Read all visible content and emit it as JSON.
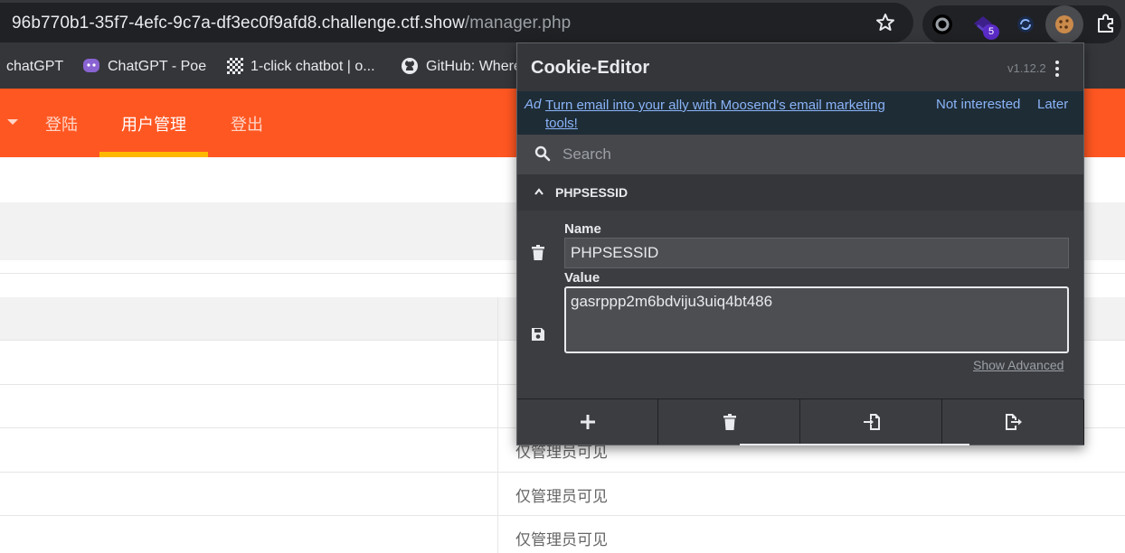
{
  "browser": {
    "url_main": "96b770b1-35f7-4efc-9c7a-df3ec0f9afd8.challenge.ctf.show",
    "url_path": "/manager.php",
    "extension_badge": "5",
    "bookmarks": [
      {
        "label": "chatGPT",
        "icon": "none"
      },
      {
        "label": "ChatGPT - Poe",
        "icon": "poe-icon"
      },
      {
        "label": "1-click chatbot | o...",
        "icon": "checker-icon"
      },
      {
        "label": "GitHub: Where",
        "icon": "github-icon"
      }
    ]
  },
  "site": {
    "nav": [
      {
        "label": "登陆",
        "active": false
      },
      {
        "label": "用户管理",
        "active": true
      },
      {
        "label": "登出",
        "active": false
      }
    ],
    "table_cells": [
      "仅管理员可见",
      "仅管理员可见",
      "仅管理员可见"
    ],
    "colors": {
      "nav_bg": "#ff5722",
      "nav_active_underline": "#ffb800"
    }
  },
  "cookie_editor": {
    "title": "Cookie-Editor",
    "version": "v1.12.2",
    "ad": {
      "tag": "Ad",
      "link_text": "Turn email into your ally with Moosend's email marketing tools!",
      "not_interested": "Not interested",
      "later": "Later"
    },
    "search_placeholder": "Search",
    "cookie": {
      "header": "PHPSESSID",
      "name_label": "Name",
      "name_value": "PHPSESSID",
      "value_label": "Value",
      "value_value": "gasrppp2m6bdviju3uiq4bt486",
      "show_advanced": "Show Advanced"
    },
    "toolbar": [
      "add-icon",
      "delete-all-icon",
      "import-icon",
      "export-icon"
    ]
  }
}
